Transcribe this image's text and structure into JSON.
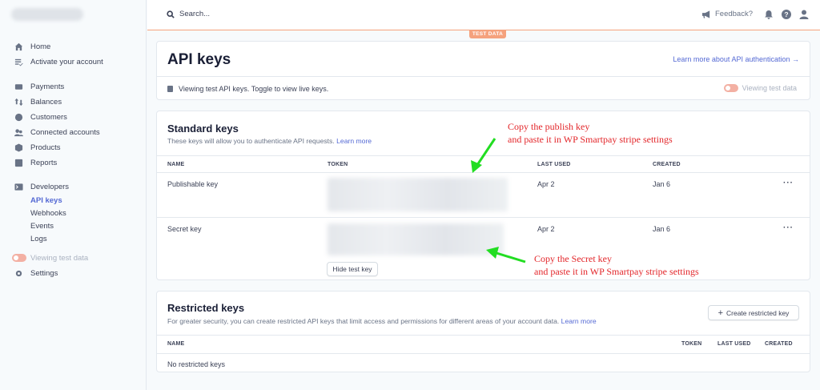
{
  "sidebar": {
    "items": [
      {
        "label": "Home",
        "icon": "home-icon"
      },
      {
        "label": "Activate your account",
        "icon": "checklist-icon"
      },
      {
        "label": "Payments",
        "icon": "payments-icon"
      },
      {
        "label": "Balances",
        "icon": "balances-icon"
      },
      {
        "label": "Customers",
        "icon": "customers-icon"
      },
      {
        "label": "Connected accounts",
        "icon": "connected-accounts-icon"
      },
      {
        "label": "Products",
        "icon": "products-icon"
      },
      {
        "label": "Reports",
        "icon": "reports-icon"
      },
      {
        "label": "Developers",
        "icon": "developers-icon"
      }
    ],
    "developer_subitems": [
      "API keys",
      "Webhooks",
      "Events",
      "Logs"
    ],
    "viewing_test_data": "Viewing test data",
    "settings": "Settings"
  },
  "topbar": {
    "search_placeholder": "Search...",
    "feedback": "Feedback?",
    "test_data_badge": "TEST DATA"
  },
  "page": {
    "title": "API keys",
    "learn_more_auth": "Learn more about API authentication →",
    "notice": "Viewing test API keys. Toggle to view live keys.",
    "viewing_test_data": "Viewing test data"
  },
  "standard_keys": {
    "title": "Standard keys",
    "description": "These keys will allow you to authenticate API requests.",
    "learn_more": "Learn more",
    "columns": [
      "NAME",
      "TOKEN",
      "LAST USED",
      "CREATED"
    ],
    "rows": [
      {
        "name": "Publishable key",
        "last_used": "Apr 2",
        "created": "Jan 6"
      },
      {
        "name": "Secret key",
        "last_used": "Apr 2",
        "created": "Jan 6"
      }
    ],
    "hide_test_key": "Hide test key"
  },
  "restricted_keys": {
    "title": "Restricted keys",
    "description": "For greater security, you can create restricted API keys that limit access and permissions for different areas of your account data.",
    "learn_more": "Learn more",
    "create_button": "Create restricted key",
    "columns": [
      "NAME",
      "TOKEN",
      "LAST USED",
      "CREATED"
    ],
    "empty": "No restricted keys"
  },
  "annotations": {
    "publish": [
      "Copy the publish key",
      "and paste it in WP Smartpay stripe settings"
    ],
    "secret": [
      "Copy the Secret key",
      "and paste it in WP Smartpay stripe settings"
    ],
    "color": "#e3262a",
    "arrow_color": "#22dd22"
  },
  "colors": {
    "accent": "#5469d4",
    "test_mode": "#f5a27d"
  }
}
